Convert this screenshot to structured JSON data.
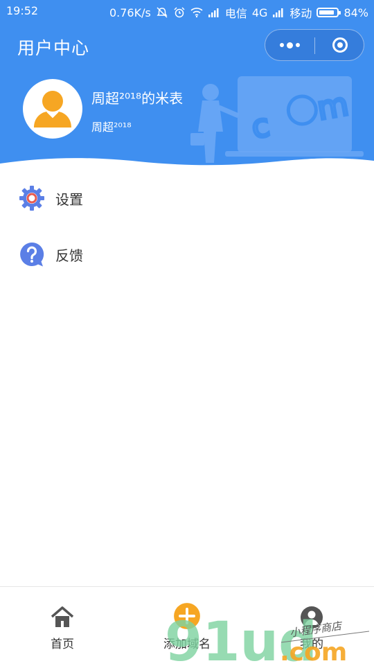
{
  "status_bar": {
    "time": "19:52",
    "speed": "0.76K/s",
    "carrier1": "电信",
    "network": "4G",
    "carrier2": "移动",
    "battery": "84%",
    "battery_level": 0.84
  },
  "nav": {
    "title": "用户中心"
  },
  "user": {
    "name": "周超²⁰¹⁸的米表",
    "sub": "周超²⁰¹⁸"
  },
  "menu": [
    {
      "label": "设置",
      "icon": "gear-icon"
    },
    {
      "label": "反馈",
      "icon": "question-icon"
    }
  ],
  "tabs": [
    {
      "label": "首页",
      "icon": "home-icon"
    },
    {
      "label": "添加域名",
      "icon": "plus-circle-icon"
    },
    {
      "label": "我的",
      "icon": "user-circle-icon"
    }
  ],
  "watermark": {
    "brand": "91ud",
    "domain": ".com",
    "slogan": "小程序商店"
  },
  "colors": {
    "header": "#3f8ff0",
    "accent_orange": "#f6a623",
    "icon_blue": "#5b7fe6",
    "gear_ring": "#e85a4f"
  }
}
